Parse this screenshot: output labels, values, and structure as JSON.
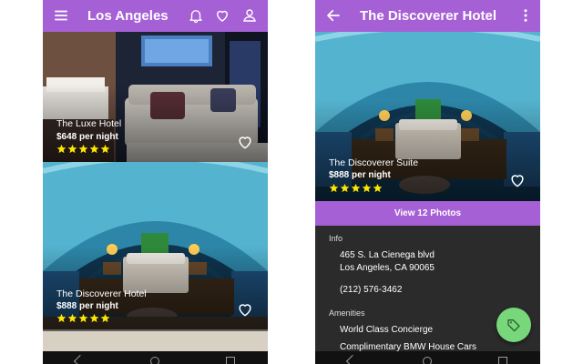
{
  "left_screen": {
    "title": "Los Angeles",
    "hotels": [
      {
        "name": "The Luxe Hotel",
        "price": "$648 per night",
        "rating": 5
      },
      {
        "name": "The Discoverer Hotel",
        "price": "$888 per night",
        "rating": 5
      }
    ],
    "icons": [
      "menu-icon",
      "bell-icon",
      "heart-icon",
      "account-icon"
    ]
  },
  "right_screen": {
    "title": "The Discoverer Hotel",
    "suite": {
      "name": "The Discoverer Suite",
      "price": "$888 per night",
      "rating": 5
    },
    "photos_button": "View 12 Photos",
    "info": {
      "label": "Info",
      "address_line1": "465 S. La Cienega blvd",
      "address_line2": "Los Angeles, CA 90065",
      "phone": "(212) 576-3462"
    },
    "amenities": {
      "label": "Amenities",
      "items": [
        "World Class Concierge",
        "Complimentary BMW House Cars"
      ]
    },
    "icons": [
      "back-arrow-icon",
      "more-vert-icon",
      "tag-icon"
    ]
  },
  "colors": {
    "app_bar": "#a660d6",
    "fab": "#77d77a",
    "star": "#ffe600",
    "panel_bg": "#2b2b2b"
  }
}
